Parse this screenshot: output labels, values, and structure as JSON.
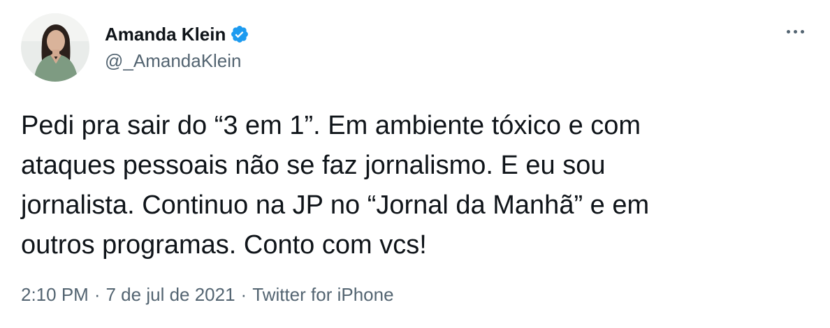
{
  "author": {
    "display_name": "Amanda Klein",
    "handle": "@_AmandaKlein",
    "verified": true,
    "avatar_icon": "profile-photo"
  },
  "tweet": {
    "text": "Pedi pra sair do “3 em 1”. Em ambiente tóxico e com\nataques pessoais não se faz jornalismo. E eu sou\njornalista. Continuo na JP no “Jornal da Manhã” e em\noutros programas. Conto com vcs!"
  },
  "meta": {
    "time": "2:10 PM",
    "separator": "·",
    "date": "7 de jul de 2021",
    "source": "Twitter for iPhone"
  },
  "colors": {
    "text_primary": "#0f1419",
    "text_secondary": "#536471",
    "verified_blue": "#1d9bf0"
  },
  "icons": {
    "more": "more-horizontal-icon",
    "verified": "verified-badge-icon"
  }
}
